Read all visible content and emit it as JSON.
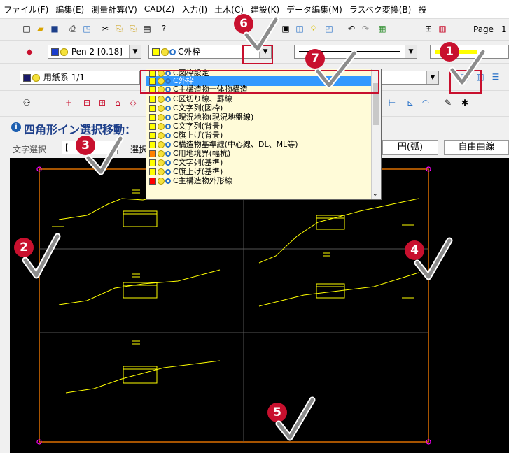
{
  "menu": [
    "ファイル(F)",
    "編集(E)",
    "測量計算(V)",
    "CAD(Z)",
    "入力(I)",
    "土木(C)",
    "建設(K)",
    "データ編集(M)",
    "ラスベク変換(B)",
    "設"
  ],
  "toolbar": {
    "page_label": "Page",
    "page_number": "1",
    "pen_combo": "Pen 2 [0.18]",
    "layer_combo": "C外枠",
    "paper_combo": "用紙系 1/1"
  },
  "command_panel": {
    "title": "四角形イン選択移動：",
    "mode_label": "文字選択",
    "mode_value": "[",
    "select_label": "選択",
    "button_arc": "円(弧)",
    "button_freecurve": "自由曲線"
  },
  "layer_dropdown": {
    "selected": "C外枠",
    "items": [
      "C外枠",
      "C区切り線、罫線",
      "C文字列(図枠)",
      "C現況地物(現況地盤線)",
      "C文字列(背景)",
      "C旗上げ(背景)",
      "C構造物基準線(中心線、DL、ML等)",
      "C用地境界(幅杭)",
      "C文字列(基準)",
      "C旗上げ(基準)",
      "C主構造物外形線"
    ],
    "item_colors": [
      "#ffff00",
      "#ffff00",
      "#ffff00",
      "#ffff00",
      "#ffff00",
      "#ffff00",
      "#ffff00",
      "#ff8000",
      "#ffff00",
      "#ffff00",
      "#ff0000"
    ]
  },
  "callouts": [
    "1",
    "2",
    "3",
    "4",
    "5",
    "6",
    "7"
  ],
  "colors": {
    "accent": "#c8102e",
    "drawing": "#ffff00",
    "frame": "#ff8000",
    "canvas": "#000000"
  }
}
